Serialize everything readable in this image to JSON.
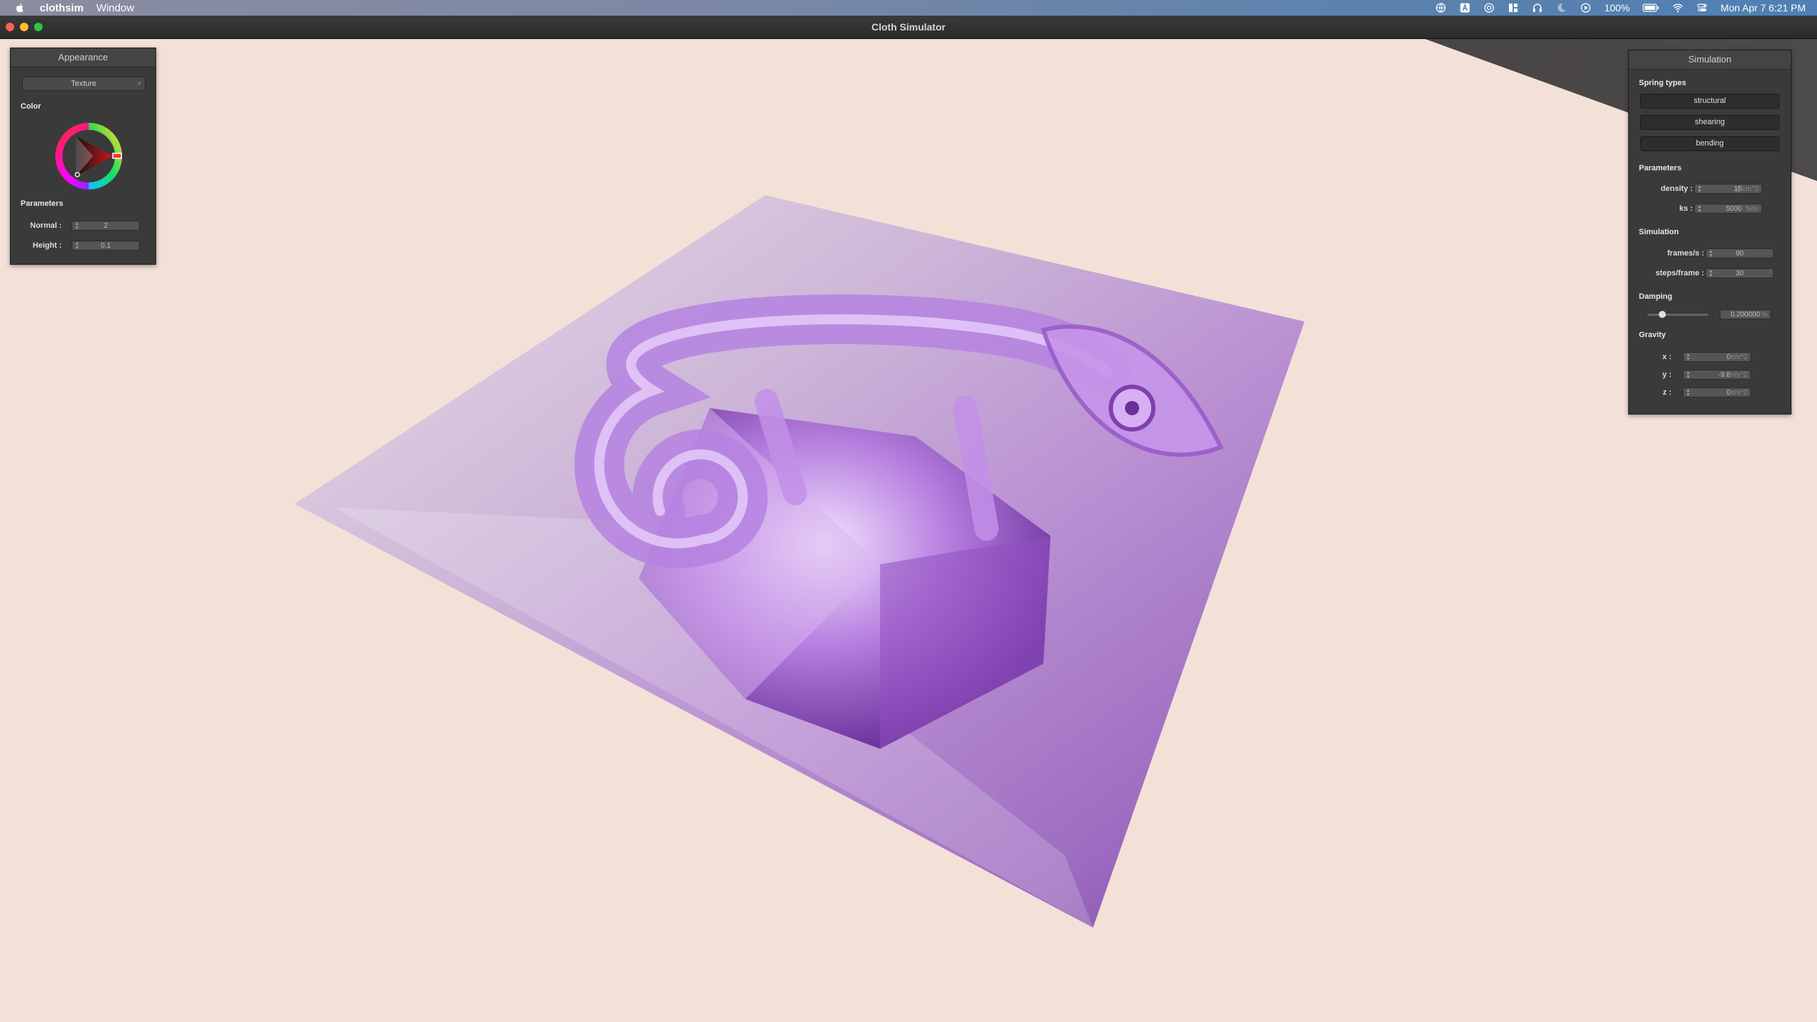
{
  "menubar": {
    "app_name": "clothsim",
    "menu_window": "Window",
    "battery": "100%",
    "clock": "Mon Apr 7  6:21 PM"
  },
  "window": {
    "title": "Cloth Simulator"
  },
  "appearance": {
    "title": "Appearance",
    "dropdown": "Texture",
    "color_label": "Color",
    "parameters_label": "Parameters",
    "normal_label": "Normal :",
    "normal_value": "2",
    "height_label": "Height :",
    "height_value": "0.1"
  },
  "simulation": {
    "title": "Simulation",
    "spring_types_label": "Spring types",
    "spring_structural": "structural",
    "spring_shearing": "shearing",
    "spring_bending": "bending",
    "parameters_label": "Parameters",
    "density_label": "density :",
    "density_value": "15",
    "density_unit": "g/cm^2",
    "ks_label": "ks :",
    "ks_value": "5000",
    "ks_unit": "N/m",
    "sim_label": "Simulation",
    "fps_label": "frames/s :",
    "fps_value": "90",
    "steps_label": "steps/frame :",
    "steps_value": "30",
    "damping_label": "Damping",
    "damping_value": "0.200000",
    "damping_unit": "%",
    "gravity_label": "Gravity",
    "gx_label": "x :",
    "gx_value": "0",
    "gy_label": "y :",
    "gy_value": "-9.8",
    "gz_label": "z :",
    "gz_value": "0",
    "gravity_unit": "m/s^2"
  }
}
